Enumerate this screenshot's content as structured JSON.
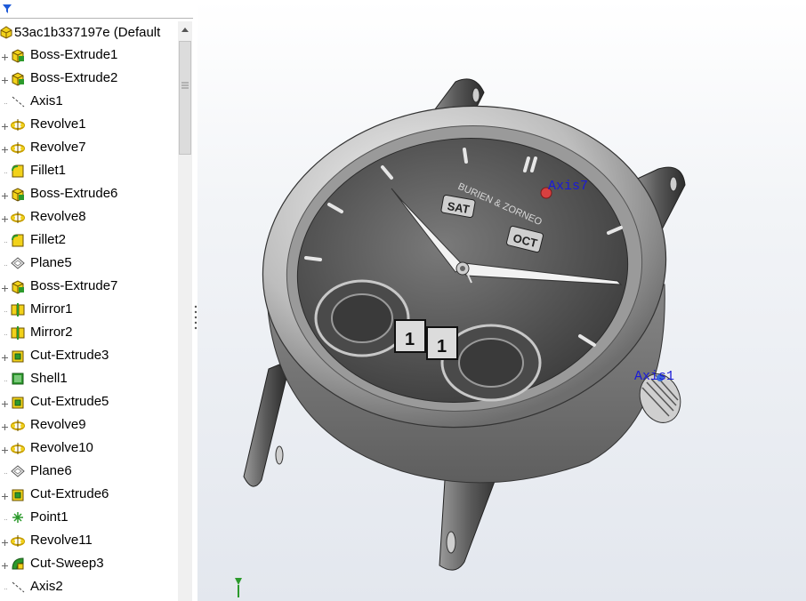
{
  "feature_tree": {
    "root": {
      "label": "53ac1b337197e  (Default",
      "icon": "part-icon"
    },
    "items": [
      {
        "label": "Boss-Extrude1",
        "icon": "extrude-icon",
        "expandable": true
      },
      {
        "label": "Boss-Extrude2",
        "icon": "extrude-icon",
        "expandable": true
      },
      {
        "label": "Axis1",
        "icon": "axis-icon",
        "expandable": false
      },
      {
        "label": "Revolve1",
        "icon": "revolve-icon",
        "expandable": true
      },
      {
        "label": "Revolve7",
        "icon": "revolve-icon",
        "expandable": true
      },
      {
        "label": "Fillet1",
        "icon": "fillet-icon",
        "expandable": false
      },
      {
        "label": "Boss-Extrude6",
        "icon": "extrude-icon",
        "expandable": true
      },
      {
        "label": "Revolve8",
        "icon": "revolve-icon",
        "expandable": true
      },
      {
        "label": "Fillet2",
        "icon": "fillet-icon",
        "expandable": false
      },
      {
        "label": "Plane5",
        "icon": "plane-icon",
        "expandable": false
      },
      {
        "label": "Boss-Extrude7",
        "icon": "extrude-icon",
        "expandable": true
      },
      {
        "label": "Mirror1",
        "icon": "mirror-icon",
        "expandable": false
      },
      {
        "label": "Mirror2",
        "icon": "mirror-icon",
        "expandable": false
      },
      {
        "label": "Cut-Extrude3",
        "icon": "cut-extrude-icon",
        "expandable": true
      },
      {
        "label": "Shell1",
        "icon": "shell-icon",
        "expandable": false
      },
      {
        "label": "Cut-Extrude5",
        "icon": "cut-extrude-icon",
        "expandable": true
      },
      {
        "label": "Revolve9",
        "icon": "revolve-icon",
        "expandable": true
      },
      {
        "label": "Revolve10",
        "icon": "revolve-icon",
        "expandable": true
      },
      {
        "label": "Plane6",
        "icon": "plane-icon",
        "expandable": false
      },
      {
        "label": "Cut-Extrude6",
        "icon": "cut-extrude-icon",
        "expandable": true
      },
      {
        "label": "Point1",
        "icon": "point-icon",
        "expandable": false
      },
      {
        "label": "Revolve11",
        "icon": "revolve-icon",
        "expandable": true
      },
      {
        "label": "Cut-Sweep3",
        "icon": "cut-sweep-icon",
        "expandable": true
      },
      {
        "label": "Axis2",
        "icon": "axis-icon",
        "expandable": false
      }
    ]
  },
  "viewport": {
    "axis_labels": [
      "Axis7",
      "Axis1"
    ],
    "dial": {
      "day_window": "SAT",
      "month_window": "OCT",
      "date_digits": [
        "1",
        "1"
      ],
      "brand": "BURIEN & ZORNEO"
    }
  },
  "colors": {
    "axis_label": "#1a1ad8",
    "feature_icon_yellow": "#f2d21a",
    "feature_icon_green": "#2c9a2c",
    "viewport_bg": "#e3e7ee"
  }
}
